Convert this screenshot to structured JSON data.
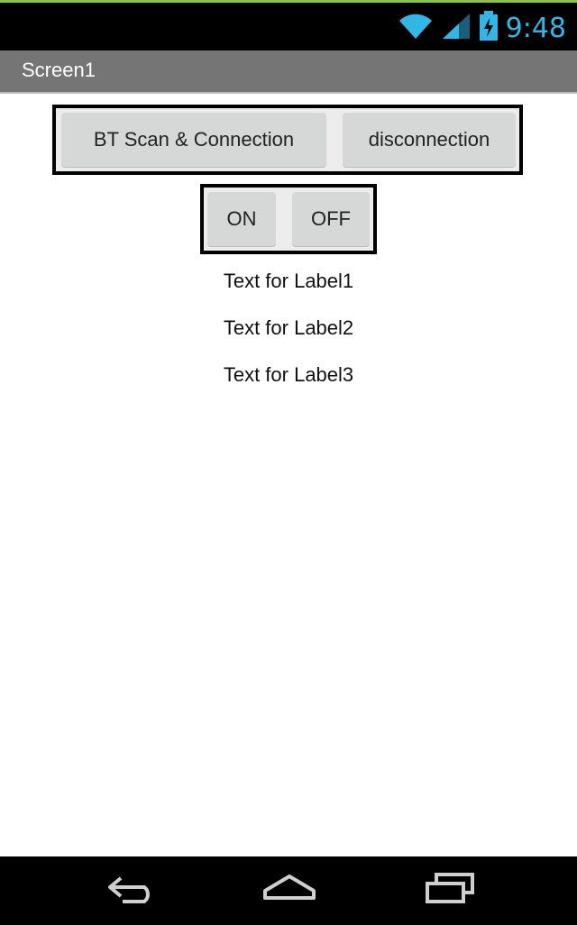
{
  "status_bar": {
    "time": "9:48"
  },
  "app": {
    "title": "Screen1"
  },
  "buttons": {
    "scan_connect": "BT Scan & Connection",
    "disconnect": "disconnection",
    "on": "ON",
    "off": "OFF"
  },
  "labels": [
    "Text for Label1",
    "Text for Label2",
    "Text for Label3"
  ]
}
